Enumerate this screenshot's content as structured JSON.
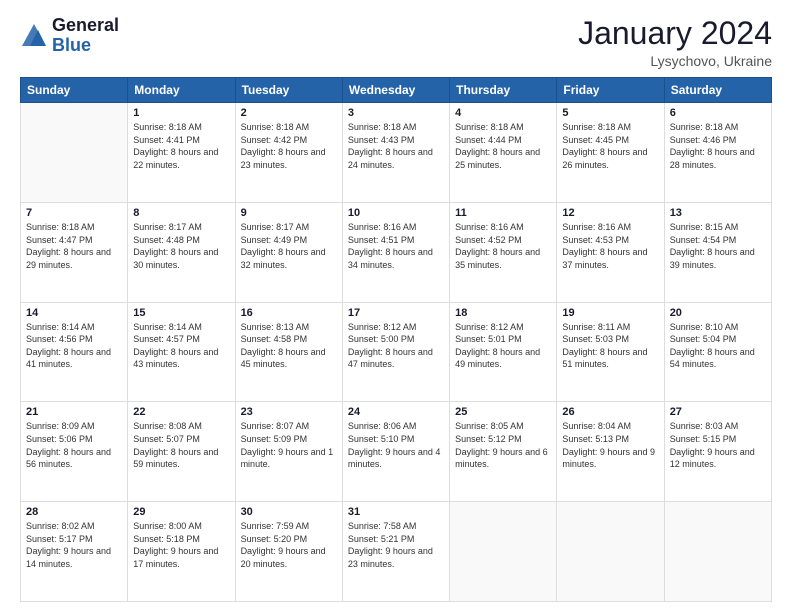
{
  "header": {
    "logo_line1": "General",
    "logo_line2": "Blue",
    "month_title": "January 2024",
    "location": "Lysychovo, Ukraine"
  },
  "weekdays": [
    "Sunday",
    "Monday",
    "Tuesday",
    "Wednesday",
    "Thursday",
    "Friday",
    "Saturday"
  ],
  "weeks": [
    [
      {
        "day": "",
        "empty": true
      },
      {
        "day": "1",
        "sunrise": "8:18 AM",
        "sunset": "4:41 PM",
        "daylight": "8 hours and 22 minutes."
      },
      {
        "day": "2",
        "sunrise": "8:18 AM",
        "sunset": "4:42 PM",
        "daylight": "8 hours and 23 minutes."
      },
      {
        "day": "3",
        "sunrise": "8:18 AM",
        "sunset": "4:43 PM",
        "daylight": "8 hours and 24 minutes."
      },
      {
        "day": "4",
        "sunrise": "8:18 AM",
        "sunset": "4:44 PM",
        "daylight": "8 hours and 25 minutes."
      },
      {
        "day": "5",
        "sunrise": "8:18 AM",
        "sunset": "4:45 PM",
        "daylight": "8 hours and 26 minutes."
      },
      {
        "day": "6",
        "sunrise": "8:18 AM",
        "sunset": "4:46 PM",
        "daylight": "8 hours and 28 minutes."
      }
    ],
    [
      {
        "day": "7",
        "sunrise": "8:18 AM",
        "sunset": "4:47 PM",
        "daylight": "8 hours and 29 minutes."
      },
      {
        "day": "8",
        "sunrise": "8:17 AM",
        "sunset": "4:48 PM",
        "daylight": "8 hours and 30 minutes."
      },
      {
        "day": "9",
        "sunrise": "8:17 AM",
        "sunset": "4:49 PM",
        "daylight": "8 hours and 32 minutes."
      },
      {
        "day": "10",
        "sunrise": "8:16 AM",
        "sunset": "4:51 PM",
        "daylight": "8 hours and 34 minutes."
      },
      {
        "day": "11",
        "sunrise": "8:16 AM",
        "sunset": "4:52 PM",
        "daylight": "8 hours and 35 minutes."
      },
      {
        "day": "12",
        "sunrise": "8:16 AM",
        "sunset": "4:53 PM",
        "daylight": "8 hours and 37 minutes."
      },
      {
        "day": "13",
        "sunrise": "8:15 AM",
        "sunset": "4:54 PM",
        "daylight": "8 hours and 39 minutes."
      }
    ],
    [
      {
        "day": "14",
        "sunrise": "8:14 AM",
        "sunset": "4:56 PM",
        "daylight": "8 hours and 41 minutes."
      },
      {
        "day": "15",
        "sunrise": "8:14 AM",
        "sunset": "4:57 PM",
        "daylight": "8 hours and 43 minutes."
      },
      {
        "day": "16",
        "sunrise": "8:13 AM",
        "sunset": "4:58 PM",
        "daylight": "8 hours and 45 minutes."
      },
      {
        "day": "17",
        "sunrise": "8:12 AM",
        "sunset": "5:00 PM",
        "daylight": "8 hours and 47 minutes."
      },
      {
        "day": "18",
        "sunrise": "8:12 AM",
        "sunset": "5:01 PM",
        "daylight": "8 hours and 49 minutes."
      },
      {
        "day": "19",
        "sunrise": "8:11 AM",
        "sunset": "5:03 PM",
        "daylight": "8 hours and 51 minutes."
      },
      {
        "day": "20",
        "sunrise": "8:10 AM",
        "sunset": "5:04 PM",
        "daylight": "8 hours and 54 minutes."
      }
    ],
    [
      {
        "day": "21",
        "sunrise": "8:09 AM",
        "sunset": "5:06 PM",
        "daylight": "8 hours and 56 minutes."
      },
      {
        "day": "22",
        "sunrise": "8:08 AM",
        "sunset": "5:07 PM",
        "daylight": "8 hours and 59 minutes."
      },
      {
        "day": "23",
        "sunrise": "8:07 AM",
        "sunset": "5:09 PM",
        "daylight": "9 hours and 1 minute."
      },
      {
        "day": "24",
        "sunrise": "8:06 AM",
        "sunset": "5:10 PM",
        "daylight": "9 hours and 4 minutes."
      },
      {
        "day": "25",
        "sunrise": "8:05 AM",
        "sunset": "5:12 PM",
        "daylight": "9 hours and 6 minutes."
      },
      {
        "day": "26",
        "sunrise": "8:04 AM",
        "sunset": "5:13 PM",
        "daylight": "9 hours and 9 minutes."
      },
      {
        "day": "27",
        "sunrise": "8:03 AM",
        "sunset": "5:15 PM",
        "daylight": "9 hours and 12 minutes."
      }
    ],
    [
      {
        "day": "28",
        "sunrise": "8:02 AM",
        "sunset": "5:17 PM",
        "daylight": "9 hours and 14 minutes."
      },
      {
        "day": "29",
        "sunrise": "8:00 AM",
        "sunset": "5:18 PM",
        "daylight": "9 hours and 17 minutes."
      },
      {
        "day": "30",
        "sunrise": "7:59 AM",
        "sunset": "5:20 PM",
        "daylight": "9 hours and 20 minutes."
      },
      {
        "day": "31",
        "sunrise": "7:58 AM",
        "sunset": "5:21 PM",
        "daylight": "9 hours and 23 minutes."
      },
      {
        "day": "",
        "empty": true
      },
      {
        "day": "",
        "empty": true
      },
      {
        "day": "",
        "empty": true
      }
    ]
  ]
}
